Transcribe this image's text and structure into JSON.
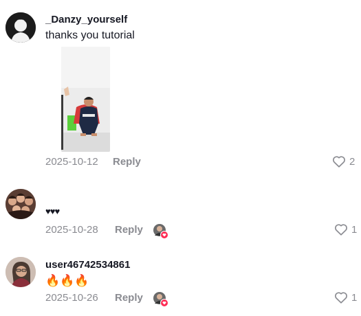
{
  "comments": [
    {
      "username": "_Danzy_yourself",
      "text": "thanks you tutorial",
      "date": "2025-10-12",
      "reply_label": "Reply",
      "likes": "2",
      "has_image": true,
      "avatar": "dark-figure-avatar"
    },
    {
      "username": "",
      "text": "♥♥♥",
      "date": "2025-10-28",
      "reply_label": "Reply",
      "likes": "1",
      "creator_liked": true,
      "avatar": "group-photo-avatar"
    },
    {
      "username": "user46742534861",
      "text": "🔥🔥🔥",
      "date": "2025-10-26",
      "reply_label": "Reply",
      "likes": "1",
      "creator_liked": true,
      "avatar": "portrait-avatar"
    }
  ],
  "colors": {
    "text": "#161823",
    "muted": "#8a8b91",
    "accent": "#fe2c55"
  }
}
